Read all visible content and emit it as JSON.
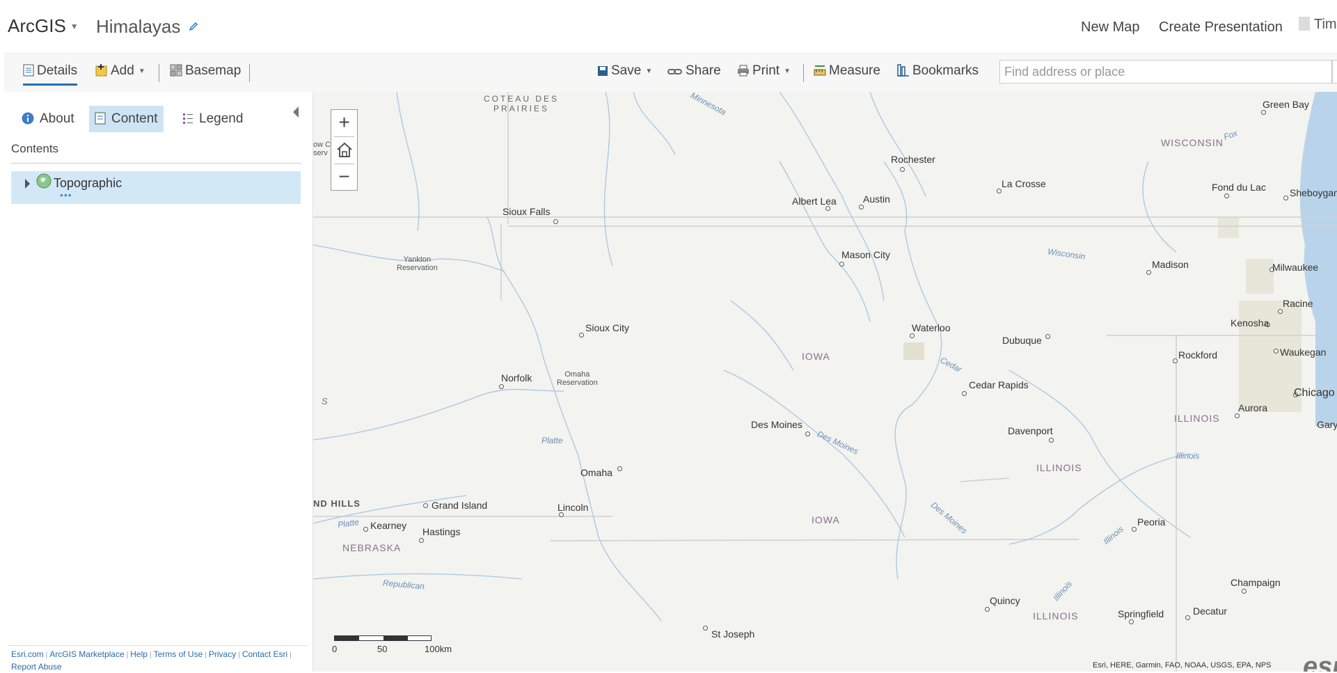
{
  "header": {
    "app_name": "ArcGIS",
    "map_title": "Himalayas",
    "new_map": "New Map",
    "create_presentation": "Create Presentation",
    "user_name": "Tim"
  },
  "toolbar": {
    "details": "Details",
    "add": "Add",
    "basemap": "Basemap",
    "save": "Save",
    "share": "Share",
    "print": "Print",
    "measure": "Measure",
    "bookmarks": "Bookmarks",
    "search_placeholder": "Find address or place"
  },
  "sidebar": {
    "tabs": {
      "about": "About",
      "content": "Content",
      "legend": "Legend"
    },
    "contents_heading": "Contents",
    "layer_name": "Topographic",
    "layer_more": "•••",
    "footer_links": [
      "Esri.com",
      "ArcGIS Marketplace",
      "Help",
      "Terms of Use",
      "Privacy",
      "Contact Esri",
      "Report Abuse"
    ]
  },
  "map": {
    "zoom_in": "+",
    "zoom_out": "−",
    "scale": {
      "labels": [
        "0",
        "50",
        "100km"
      ]
    },
    "attribution": "Esri, HERE, Garmin, FAO, NOAA, USGS, EPA, NPS",
    "logo": "esri",
    "cities": [
      "Rochester",
      "La Crosse",
      "Green Bay",
      "Fond du Lac",
      "Sheboygan",
      "Albert Lea",
      "Austin",
      "Sioux Falls",
      "Mason City",
      "Madison",
      "Milwaukee",
      "Racine",
      "Kenosha",
      "Waukegan",
      "Sioux City",
      "Waterloo",
      "Dubuque",
      "Rockford",
      "Norfolk",
      "Cedar Rapids",
      "Chicago",
      "Aurora",
      "Des Moines",
      "Davenport",
      "Gary",
      "Omaha",
      "Grand Island",
      "Lincoln",
      "Kearney",
      "Hastings",
      "Peoria",
      "Champaign",
      "Quincy",
      "Springfield",
      "Decatur",
      "St Joseph"
    ],
    "states": [
      "WISCONSIN",
      "IOWA",
      "IOWA",
      "ILLINOIS",
      "ILLINOIS",
      "ILLINOIS",
      "NEBRASKA"
    ],
    "rivers": [
      "Minnesota",
      "Wisconsin",
      "Fox",
      "Cedar",
      "Des Moines",
      "Des Moines",
      "Platte",
      "Platte",
      "Republican",
      "Illinois",
      "Illinois",
      "Illinois"
    ],
    "regions": [
      "COTEAU DES",
      "PRAIRIES",
      "Yankton",
      "Reservation",
      "Omaha",
      "Reservation",
      "ND HILLS",
      "S",
      "ow C",
      "serv"
    ]
  }
}
